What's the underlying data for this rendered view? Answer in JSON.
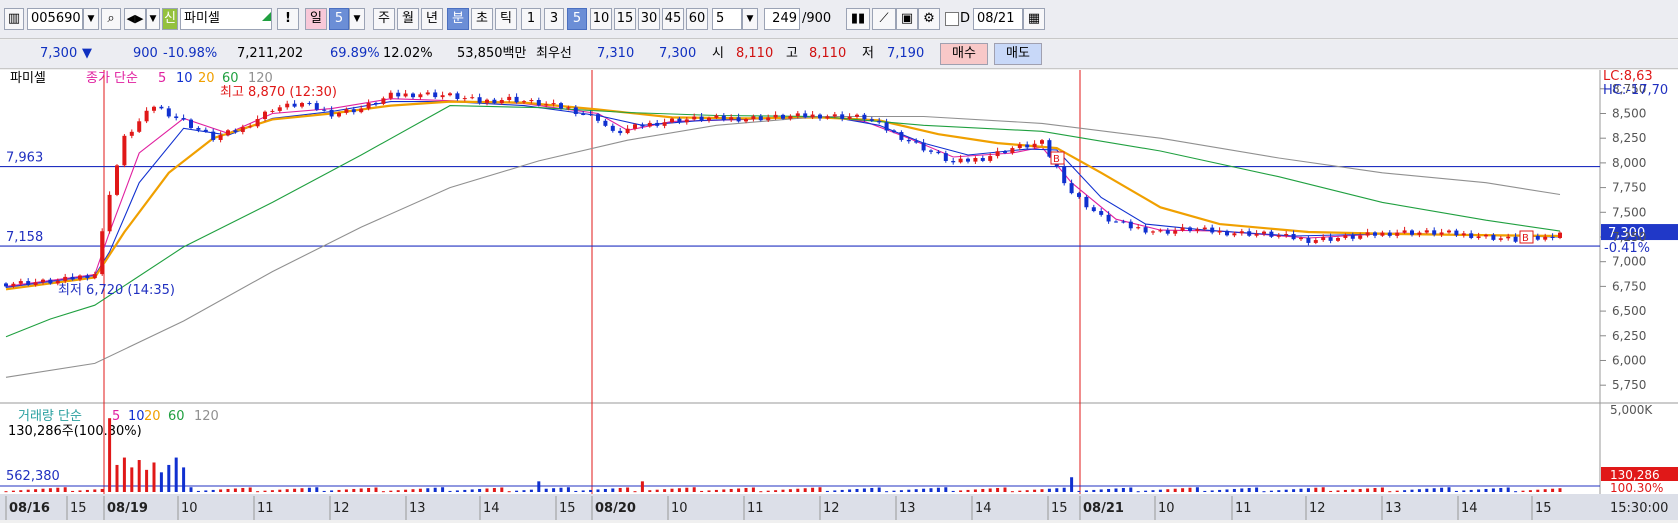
{
  "toolbar": {
    "code": "005690",
    "badge": "신",
    "name": "파미셀",
    "exclaim": "!",
    "periods": [
      "일",
      "5",
      "주",
      "월",
      "년",
      "분",
      "초",
      "틱"
    ],
    "intervals": [
      "1",
      "3",
      "5",
      "10",
      "15",
      "30",
      "45",
      "60"
    ],
    "interval_selected": "5",
    "unit_value": "5",
    "count": "249",
    "count_max": "/900",
    "date_check": "D",
    "date": "08/21"
  },
  "infobar": {
    "price": "7,300",
    "arrow": "▼",
    "change": "900",
    "change_pct": "-10.98%",
    "volume": "7,211,202",
    "vol_ratio": "69.89%",
    "turnover": "12.02%",
    "amount": "53,850백만",
    "best_label": "최우선",
    "ask": "7,310",
    "bid": "7,300",
    "open_label": "시",
    "open": "8,110",
    "high_label": "고",
    "high": "8,110",
    "low_label": "저",
    "low": "7,190",
    "buy": "매수",
    "sell": "매도"
  },
  "colors": {
    "up": "#e01818",
    "down": "#1030d0",
    "ma5": "#e020a0",
    "ma10": "#1030d0",
    "ma20": "#f0a000",
    "ma60": "#20a040",
    "ma120": "#909090",
    "divider": "#e01818",
    "hline": "#2030c0"
  },
  "chart_data": {
    "type": "candlestick",
    "title": "파미셀",
    "legend": {
      "price_label": "종가 단순",
      "periods": [
        "5",
        "10",
        "20",
        "60",
        "120"
      ],
      "volume_label": "거래량 단순"
    },
    "y_ticks": [
      "8,750",
      "8,500",
      "8,250",
      "8,000",
      "7,750",
      "7,500",
      "7,250",
      "7,000",
      "6,750",
      "6,500",
      "6,250",
      "6,000",
      "5,750"
    ],
    "ylim": [
      5600,
      8920
    ],
    "vol_ticks": [
      "5,000K"
    ],
    "vol_max": 5000000,
    "corner_labels": {
      "lc": "LC:8,63",
      "hc": "HC:-17,70"
    },
    "max_note": "최고 8,870 (12:30)",
    "min_note": "최저 6,720 (14:35)",
    "hlines": [
      {
        "label": "7,963",
        "value": 7963
      },
      {
        "label": "7,158",
        "value": 7158
      }
    ],
    "current": {
      "value": 7300,
      "label": "7,300",
      "pct": "-0.41%"
    },
    "volume_current": {
      "label": "130,286",
      "pct": "100.30%"
    },
    "volume_note": "130,286주(100.30%)",
    "volume_ref_label": "562,380",
    "x_labels": [
      "08/16",
      "15",
      "08/19",
      "10",
      "11",
      "12",
      "13",
      "14",
      "15",
      "08/20",
      "10",
      "11",
      "12",
      "13",
      "14",
      "15",
      "08/21",
      "10",
      "11",
      "12",
      "13",
      "14",
      "15"
    ],
    "time_label": "15:30:00",
    "signal_label": "B",
    "close_path": [
      [
        0,
        6780
      ],
      [
        7,
        6800
      ],
      [
        12,
        6880
      ],
      [
        14,
        7700
      ],
      [
        16,
        8250
      ],
      [
        20,
        8580
      ],
      [
        24,
        8420
      ],
      [
        28,
        8250
      ],
      [
        32,
        8350
      ],
      [
        36,
        8550
      ],
      [
        40,
        8600
      ],
      [
        44,
        8500
      ],
      [
        48,
        8550
      ],
      [
        52,
        8680
      ],
      [
        56,
        8700
      ],
      [
        60,
        8680
      ],
      [
        64,
        8620
      ],
      [
        68,
        8650
      ],
      [
        72,
        8600
      ],
      [
        76,
        8550
      ],
      [
        80,
        8450
      ],
      [
        82,
        8300
      ],
      [
        86,
        8380
      ],
      [
        90,
        8430
      ],
      [
        94,
        8450
      ],
      [
        100,
        8450
      ],
      [
        110,
        8480
      ],
      [
        116,
        8460
      ],
      [
        120,
        8300
      ],
      [
        124,
        8150
      ],
      [
        128,
        8000
      ],
      [
        132,
        8050
      ],
      [
        136,
        8150
      ],
      [
        140,
        8200
      ],
      [
        144,
        7700
      ],
      [
        148,
        7450
      ],
      [
        152,
        7350
      ],
      [
        156,
        7300
      ],
      [
        160,
        7330
      ],
      [
        164,
        7300
      ],
      [
        170,
        7280
      ],
      [
        176,
        7220
      ],
      [
        182,
        7250
      ],
      [
        188,
        7300
      ],
      [
        194,
        7290
      ],
      [
        198,
        7270
      ],
      [
        204,
        7220
      ],
      [
        208,
        7240
      ],
      [
        210,
        7300
      ]
    ],
    "ma_series": [
      {
        "period": "5",
        "points": [
          [
            0,
            6750
          ],
          [
            12,
            6870
          ],
          [
            14,
            7300
          ],
          [
            18,
            8100
          ],
          [
            24,
            8450
          ],
          [
            30,
            8300
          ],
          [
            36,
            8500
          ],
          [
            44,
            8550
          ],
          [
            52,
            8650
          ],
          [
            60,
            8630
          ],
          [
            70,
            8600
          ],
          [
            80,
            8500
          ],
          [
            84,
            8330
          ],
          [
            90,
            8420
          ],
          [
            100,
            8440
          ],
          [
            110,
            8470
          ],
          [
            116,
            8420
          ],
          [
            122,
            8250
          ],
          [
            128,
            8060
          ],
          [
            136,
            8100
          ],
          [
            140,
            8160
          ],
          [
            144,
            7800
          ],
          [
            150,
            7430
          ],
          [
            156,
            7320
          ],
          [
            164,
            7310
          ],
          [
            176,
            7240
          ],
          [
            188,
            7290
          ],
          [
            198,
            7270
          ],
          [
            210,
            7260
          ]
        ]
      },
      {
        "period": "10",
        "points": [
          [
            0,
            6740
          ],
          [
            12,
            6860
          ],
          [
            14,
            7100
          ],
          [
            18,
            7800
          ],
          [
            24,
            8350
          ],
          [
            30,
            8280
          ],
          [
            36,
            8450
          ],
          [
            44,
            8520
          ],
          [
            52,
            8620
          ],
          [
            60,
            8620
          ],
          [
            70,
            8580
          ],
          [
            80,
            8480
          ],
          [
            86,
            8380
          ],
          [
            94,
            8430
          ],
          [
            104,
            8450
          ],
          [
            112,
            8460
          ],
          [
            118,
            8380
          ],
          [
            124,
            8200
          ],
          [
            130,
            8080
          ],
          [
            138,
            8140
          ],
          [
            142,
            8130
          ],
          [
            148,
            7650
          ],
          [
            154,
            7380
          ],
          [
            162,
            7320
          ],
          [
            174,
            7260
          ],
          [
            186,
            7280
          ],
          [
            198,
            7270
          ],
          [
            210,
            7250
          ]
        ]
      },
      {
        "period": "20",
        "points": [
          [
            0,
            6720
          ],
          [
            12,
            6840
          ],
          [
            16,
            7300
          ],
          [
            22,
            7900
          ],
          [
            28,
            8250
          ],
          [
            36,
            8440
          ],
          [
            44,
            8500
          ],
          [
            52,
            8580
          ],
          [
            60,
            8620
          ],
          [
            70,
            8610
          ],
          [
            80,
            8540
          ],
          [
            90,
            8460
          ],
          [
            100,
            8450
          ],
          [
            110,
            8460
          ],
          [
            118,
            8430
          ],
          [
            126,
            8290
          ],
          [
            134,
            8200
          ],
          [
            142,
            8150
          ],
          [
            148,
            7900
          ],
          [
            156,
            7550
          ],
          [
            164,
            7380
          ],
          [
            176,
            7300
          ],
          [
            188,
            7280
          ],
          [
            198,
            7270
          ],
          [
            210,
            7260
          ]
        ]
      },
      {
        "period": "60",
        "points": [
          [
            0,
            6240
          ],
          [
            6,
            6420
          ],
          [
            12,
            6560
          ],
          [
            24,
            7150
          ],
          [
            36,
            7600
          ],
          [
            48,
            8080
          ],
          [
            60,
            8580
          ],
          [
            72,
            8560
          ],
          [
            84,
            8510
          ],
          [
            96,
            8480
          ],
          [
            110,
            8470
          ],
          [
            124,
            8380
          ],
          [
            140,
            8320
          ],
          [
            156,
            8120
          ],
          [
            172,
            7860
          ],
          [
            186,
            7600
          ],
          [
            200,
            7420
          ],
          [
            210,
            7310
          ]
        ]
      },
      {
        "period": "120",
        "points": [
          [
            0,
            5830
          ],
          [
            12,
            5970
          ],
          [
            24,
            6400
          ],
          [
            36,
            6900
          ],
          [
            48,
            7350
          ],
          [
            60,
            7750
          ],
          [
            72,
            8020
          ],
          [
            84,
            8230
          ],
          [
            96,
            8380
          ],
          [
            110,
            8470
          ],
          [
            124,
            8470
          ],
          [
            140,
            8400
          ],
          [
            156,
            8250
          ],
          [
            172,
            8050
          ],
          [
            186,
            7900
          ],
          [
            200,
            7800
          ],
          [
            210,
            7680
          ]
        ]
      }
    ]
  }
}
